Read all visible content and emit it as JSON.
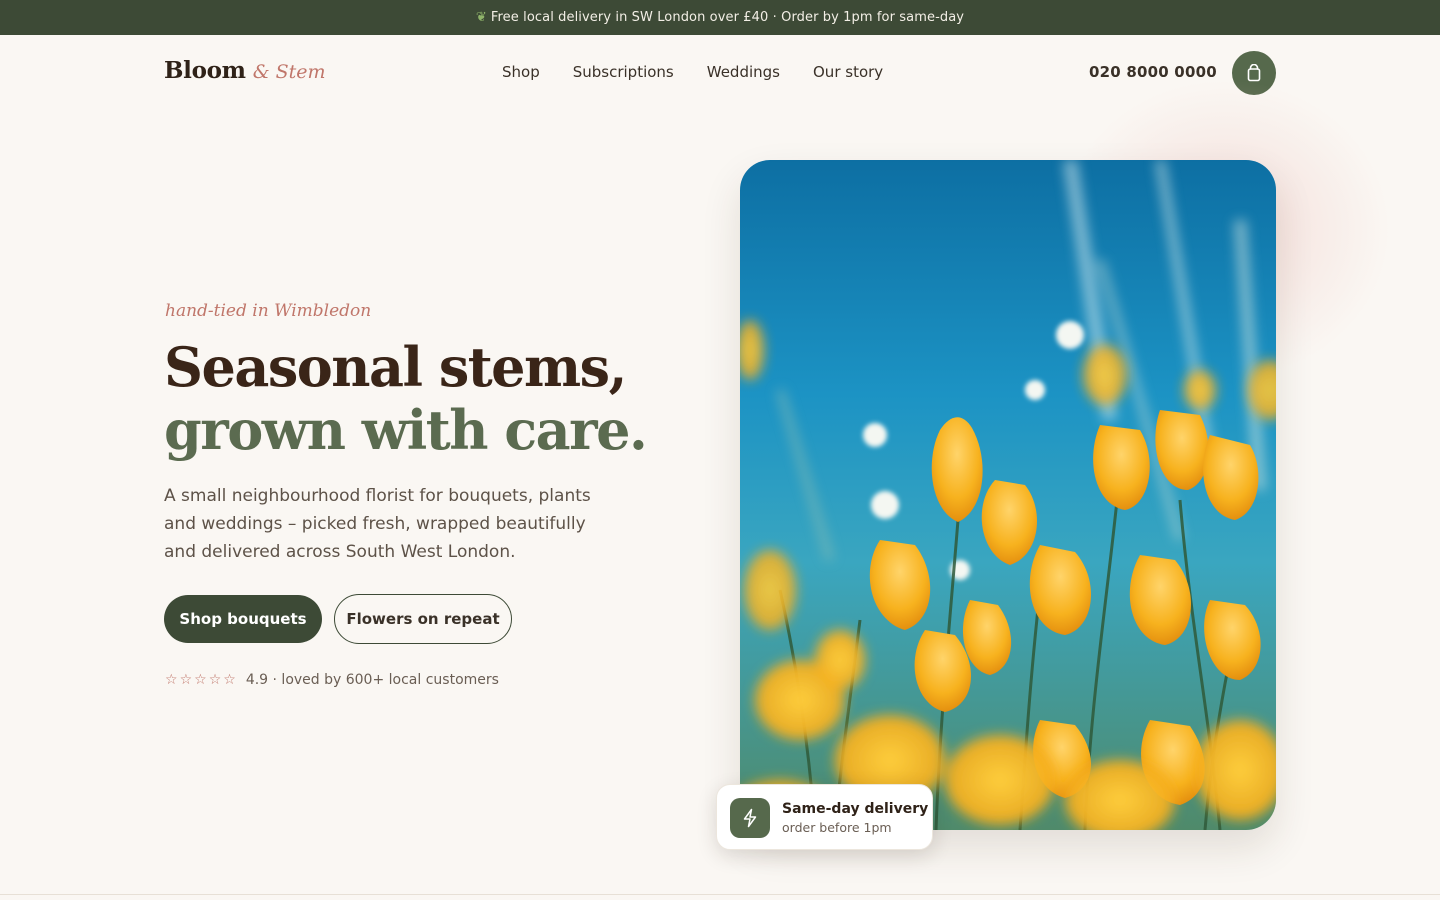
{
  "announcement": {
    "icon": "leaf-icon",
    "text": "Free local delivery in SW London over £40 · Order by 1pm for same-day"
  },
  "header": {
    "logo_name": "Bloom",
    "logo_suffix": "& Stem",
    "nav": [
      {
        "label": "Shop"
      },
      {
        "label": "Subscriptions"
      },
      {
        "label": "Weddings"
      },
      {
        "label": "Our story"
      }
    ],
    "phone": "020 8000 0000",
    "cart_icon": "shopping-bag-icon"
  },
  "hero": {
    "kicker": "hand-tied in Wimbledon",
    "headline_line1": "Seasonal stems,",
    "headline_line2": "grown with care.",
    "description": "A small neighbourhood florist for bouquets, plants and weddings – picked fresh, wrapped beautifully and delivered across South West London.",
    "primary_cta": "Shop bouquets",
    "secondary_cta": "Flowers on repeat",
    "rating_stars": 5,
    "rating_text": "4.9 · loved by 600+ local customers",
    "image": "orange-poppies-photo"
  },
  "badge": {
    "icon": "lightning-icon",
    "title": "Same-day delivery",
    "subtitle": "order before 1pm"
  },
  "colors": {
    "forest": "#3d4a36",
    "sage": "#5b6b50",
    "rose": "#c0766a",
    "cream": "#faf7f3",
    "brown": "#3a2518"
  }
}
